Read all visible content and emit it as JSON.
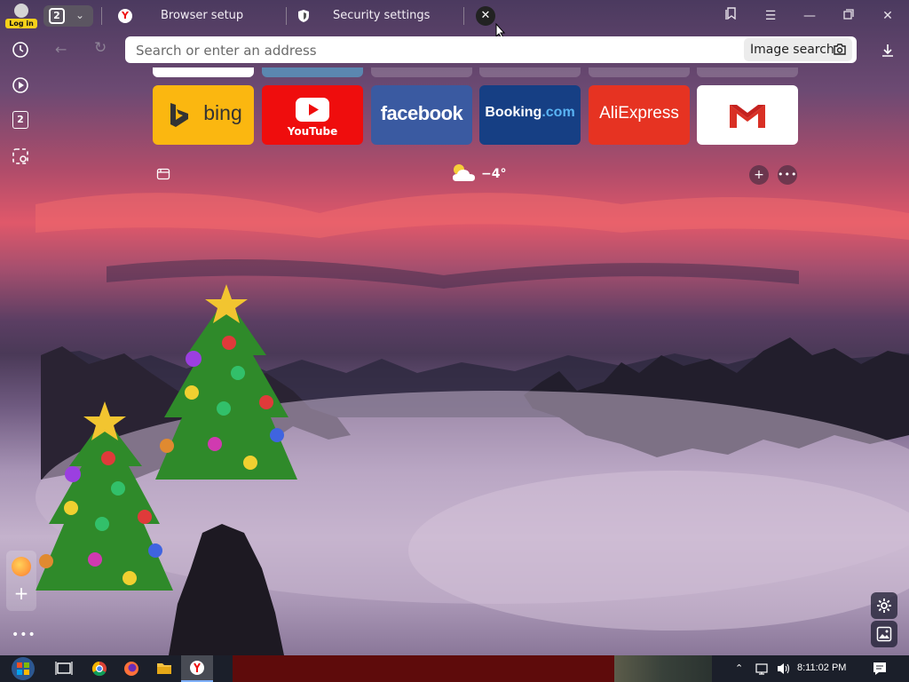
{
  "titlebar": {
    "login_label": "Log in",
    "tab_count": "2",
    "tabs": [
      {
        "title": "Browser setup",
        "icon": "yandex-icon"
      },
      {
        "title": "Security settings",
        "icon": "shield-icon"
      }
    ]
  },
  "address_bar": {
    "placeholder": "Search or enter an address",
    "image_search_label": "Image search"
  },
  "sidebar": {
    "tabs_badge": "2"
  },
  "tiles": [
    {
      "name": "bing",
      "color": "#fbb710"
    },
    {
      "name": "YouTube",
      "color": "#ef0d0d"
    },
    {
      "name": "facebook",
      "color": "#3a5aa1"
    },
    {
      "name": "Booking",
      "suffix": ".com",
      "color": "#163f84"
    },
    {
      "name": "AliExpress",
      "color": "#e63322"
    },
    {
      "name": "Gmail",
      "color": "#ffffff",
      "icon": "gmail-icon"
    }
  ],
  "weather": {
    "temp": "−4°",
    "icon": "partly-cloudy-icon"
  },
  "taskbar": {
    "time": "8:11:02 PM",
    "apps": [
      "start",
      "task-view",
      "chrome",
      "firefox",
      "file-explorer",
      "yandex-browser"
    ]
  }
}
